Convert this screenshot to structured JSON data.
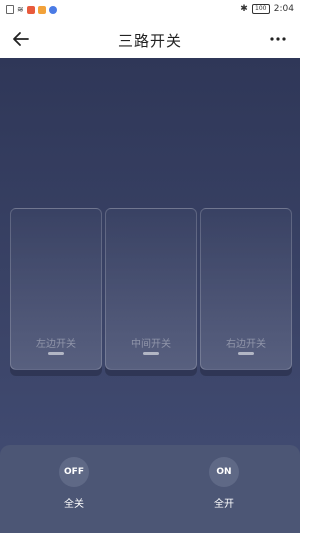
{
  "status_bar": {
    "time": "2:04",
    "battery": "100"
  },
  "app_bar": {
    "title": "三路开关"
  },
  "switches": [
    {
      "label": "左边开关"
    },
    {
      "label": "中间开关"
    },
    {
      "label": "右边开关"
    }
  ],
  "actions": {
    "all_off": {
      "button": "OFF",
      "label": "全关"
    },
    "all_on": {
      "button": "ON",
      "label": "全开"
    }
  },
  "colors": {
    "background_top": "#2f3758",
    "background_bottom": "#434e76",
    "panel": "#4c5675",
    "button_circle": "#5f6986"
  }
}
